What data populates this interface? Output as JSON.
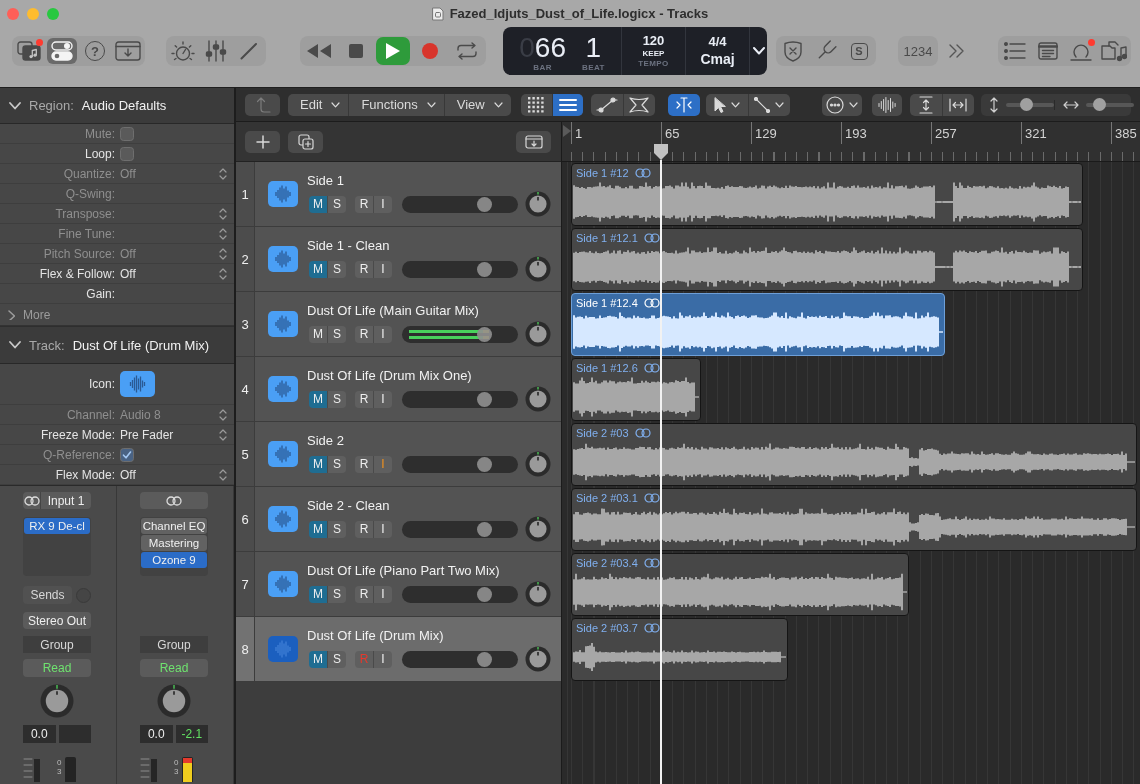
{
  "window": {
    "title": "Fazed_Idjuts_Dust_of_Life.logicx - Tracks"
  },
  "control_bar": {
    "view_toggles": [
      {
        "kind": "library",
        "selected": false,
        "badge": true
      },
      {
        "kind": "controls",
        "selected": true,
        "badge": false
      },
      {
        "kind": "help",
        "label": "?",
        "selected": false,
        "badge": false
      },
      {
        "kind": "downloads",
        "selected": false,
        "badge": false
      }
    ],
    "editors": [
      {
        "kind": "dial"
      },
      {
        "kind": "mixer"
      },
      {
        "kind": "pencil"
      }
    ],
    "transport": [
      {
        "kind": "rewind",
        "on": false
      },
      {
        "kind": "stop",
        "on": false
      },
      {
        "kind": "play",
        "on": true
      },
      {
        "kind": "record",
        "on": false
      },
      {
        "kind": "cycle",
        "on": false
      }
    ],
    "lcd": {
      "bar_leading": "0",
      "bar": "66",
      "bar_label": "BAR",
      "beat": "1",
      "beat_label": "BEAT",
      "tempo": "120",
      "tempo_mode": "KEEP",
      "tempo_label": "TEMPO",
      "signature": "4/4",
      "key": "Cmaj"
    },
    "modes": [
      {
        "kind": "shield"
      },
      {
        "kind": "tuner"
      },
      {
        "kind": "solo",
        "label": "S"
      }
    ],
    "count_in": "1234",
    "panels": [
      {
        "kind": "list",
        "badge": false
      },
      {
        "kind": "notes",
        "badge": false
      },
      {
        "kind": "loops",
        "badge": true
      },
      {
        "kind": "browser",
        "badge": false
      }
    ]
  },
  "inspector": {
    "region": {
      "label": "Region:",
      "title": "Audio Defaults",
      "expanded": true,
      "rows": [
        {
          "kind": "checkbox",
          "label": "Mute:",
          "enabled": false,
          "checked": false
        },
        {
          "kind": "checkbox",
          "label": "Loop:",
          "enabled": true,
          "checked": false
        },
        {
          "kind": "popup",
          "label": "Quantize:",
          "value": "Off",
          "enabled": false
        },
        {
          "kind": "text",
          "label": "Q-Swing:",
          "enabled": false
        },
        {
          "kind": "popup",
          "label": "Transpose:",
          "enabled": false
        },
        {
          "kind": "popup",
          "label": "Fine Tune:",
          "enabled": false
        },
        {
          "kind": "popup",
          "label": "Pitch Source:",
          "value": "Off",
          "enabled": false
        },
        {
          "kind": "popup",
          "label": "Flex & Follow:",
          "value": "Off",
          "enabled": true
        },
        {
          "kind": "text",
          "label": "Gain:",
          "enabled": true
        }
      ],
      "more": {
        "label": "More",
        "expanded": false
      }
    },
    "track": {
      "label": "Track:",
      "title": "Dust Of Life (Drum Mix)",
      "expanded": true,
      "rows": [
        {
          "kind": "icon",
          "label": "Icon:",
          "enabled": true
        },
        {
          "kind": "popup",
          "label": "Channel:",
          "value": "Audio 8",
          "enabled": false
        },
        {
          "kind": "popup",
          "label": "Freeze Mode:",
          "value": "Pre Fader",
          "enabled": true
        },
        {
          "kind": "checkbox",
          "label": "Q-Reference:",
          "enabled": false,
          "checked": true
        },
        {
          "kind": "popup",
          "label": "Flex Mode:",
          "value": "Off",
          "enabled": true
        }
      ]
    },
    "strips": [
      {
        "input": "Input 1",
        "plugins": [
          {
            "name": "RX 9 De-cl",
            "selected": true
          }
        ],
        "sends": "Sends",
        "output": "Stereo Out",
        "group": "Group",
        "automation": "Read",
        "volume": "0.0",
        "meter_scale": [
          "0",
          "3"
        ]
      },
      {
        "plugins": [
          {
            "name": "Channel EQ",
            "selected": false
          },
          {
            "name": "Mastering",
            "selected": false
          },
          {
            "name": "Ozone 9",
            "selected": true
          }
        ],
        "group": "Group",
        "automation": "Read",
        "volume": "0.0",
        "peak": "-2.1",
        "meter_scale": [
          "0",
          "3"
        ],
        "meter": {
          "level": 0.95
        }
      }
    ]
  },
  "tracks_toolbar": {
    "menus": [
      {
        "label": "Edit"
      },
      {
        "label": "Functions"
      },
      {
        "label": "View"
      }
    ],
    "view_mode": [
      {
        "kind": "grid",
        "selected": false
      },
      {
        "kind": "list",
        "selected": true
      }
    ],
    "edit_modes": [
      {
        "kind": "automation",
        "on": false
      },
      {
        "kind": "flex",
        "on": false
      }
    ],
    "catch": {
      "on": true
    },
    "zoom": [
      {
        "kind": "vertical",
        "level": 0.4
      },
      {
        "kind": "horizontal",
        "level": 0.22
      }
    ]
  },
  "tracks": [
    {
      "number": "1",
      "name": "Side 1",
      "selected": false,
      "buttons": [
        {
          "kind": "mute",
          "label": "M",
          "on": true
        },
        {
          "kind": "solo",
          "label": "S",
          "on": false
        },
        {
          "kind": "record",
          "label": "R",
          "on": false
        },
        {
          "kind": "input",
          "label": "I",
          "on": false
        }
      ],
      "fader": {
        "level": 0.74
      },
      "meter": {
        "level": 0
      },
      "region": {
        "name": "Side 1 #12",
        "selected": false
      }
    },
    {
      "number": "2",
      "name": "Side 1 - Clean",
      "selected": false,
      "buttons": [
        {
          "kind": "mute",
          "label": "M",
          "on": true
        },
        {
          "kind": "solo",
          "label": "S",
          "on": false
        },
        {
          "kind": "record",
          "label": "R",
          "on": false
        },
        {
          "kind": "input",
          "label": "I",
          "on": false
        }
      ],
      "fader": {
        "level": 0.74
      },
      "meter": {
        "level": 0
      },
      "region": {
        "name": "Side 1 #12.1",
        "selected": false
      }
    },
    {
      "number": "3",
      "name": "Dust Of Life (Main Guitar Mix)",
      "selected": false,
      "buttons": [
        {
          "kind": "mute",
          "label": "M",
          "on": false
        },
        {
          "kind": "solo",
          "label": "S",
          "on": false
        },
        {
          "kind": "record",
          "label": "R",
          "on": false
        },
        {
          "kind": "input",
          "label": "I",
          "on": false
        }
      ],
      "fader": {
        "level": 0.74
      },
      "meter": {
        "level": 0.75
      },
      "region": {
        "name": "Side 1 #12.4",
        "selected": true
      }
    },
    {
      "number": "4",
      "name": "Dust Of Life (Drum Mix One)",
      "selected": false,
      "buttons": [
        {
          "kind": "mute",
          "label": "M",
          "on": true
        },
        {
          "kind": "solo",
          "label": "S",
          "on": false
        },
        {
          "kind": "record",
          "label": "R",
          "on": false
        },
        {
          "kind": "input",
          "label": "I",
          "on": false
        }
      ],
      "fader": {
        "level": 0.74
      },
      "meter": {
        "level": 0
      },
      "region": {
        "name": "Side 1 #12.6",
        "selected": false
      }
    },
    {
      "number": "5",
      "name": "Side 2",
      "selected": false,
      "buttons": [
        {
          "kind": "mute",
          "label": "M",
          "on": true
        },
        {
          "kind": "solo",
          "label": "S",
          "on": false
        },
        {
          "kind": "record",
          "label": "R",
          "on": false
        },
        {
          "kind": "input",
          "label": "I",
          "on": true
        }
      ],
      "fader": {
        "level": 0.74
      },
      "meter": {
        "level": 0
      },
      "region": {
        "name": "Side 2 #03",
        "selected": false
      }
    },
    {
      "number": "6",
      "name": "Side 2 - Clean",
      "selected": false,
      "buttons": [
        {
          "kind": "mute",
          "label": "M",
          "on": true
        },
        {
          "kind": "solo",
          "label": "S",
          "on": false
        },
        {
          "kind": "record",
          "label": "R",
          "on": false
        },
        {
          "kind": "input",
          "label": "I",
          "on": false
        }
      ],
      "fader": {
        "level": 0.74
      },
      "meter": {
        "level": 0
      },
      "region": {
        "name": "Side 2 #03.1",
        "selected": false
      }
    },
    {
      "number": "7",
      "name": "Dust Of Life (Piano Part Two Mix)",
      "selected": false,
      "buttons": [
        {
          "kind": "mute",
          "label": "M",
          "on": true
        },
        {
          "kind": "solo",
          "label": "S",
          "on": false
        },
        {
          "kind": "record",
          "label": "R",
          "on": false
        },
        {
          "kind": "input",
          "label": "I",
          "on": false
        }
      ],
      "fader": {
        "level": 0.74
      },
      "meter": {
        "level": 0
      },
      "region": {
        "name": "Side 2 #03.4",
        "selected": false
      }
    },
    {
      "number": "8",
      "name": "Dust Of Life (Drum Mix)",
      "selected": true,
      "buttons": [
        {
          "kind": "mute",
          "label": "M",
          "on": true
        },
        {
          "kind": "solo",
          "label": "S",
          "on": false
        },
        {
          "kind": "record",
          "label": "R",
          "on": true
        },
        {
          "kind": "input",
          "label": "I",
          "on": false
        }
      ],
      "fader": {
        "level": 0.74
      },
      "meter": {
        "level": 0
      },
      "region": {
        "name": "Side 2 #03.7",
        "selected": false
      }
    }
  ],
  "ruler": {
    "labels": [
      "1",
      "65",
      "129",
      "193",
      "257",
      "321",
      "385"
    ]
  }
}
